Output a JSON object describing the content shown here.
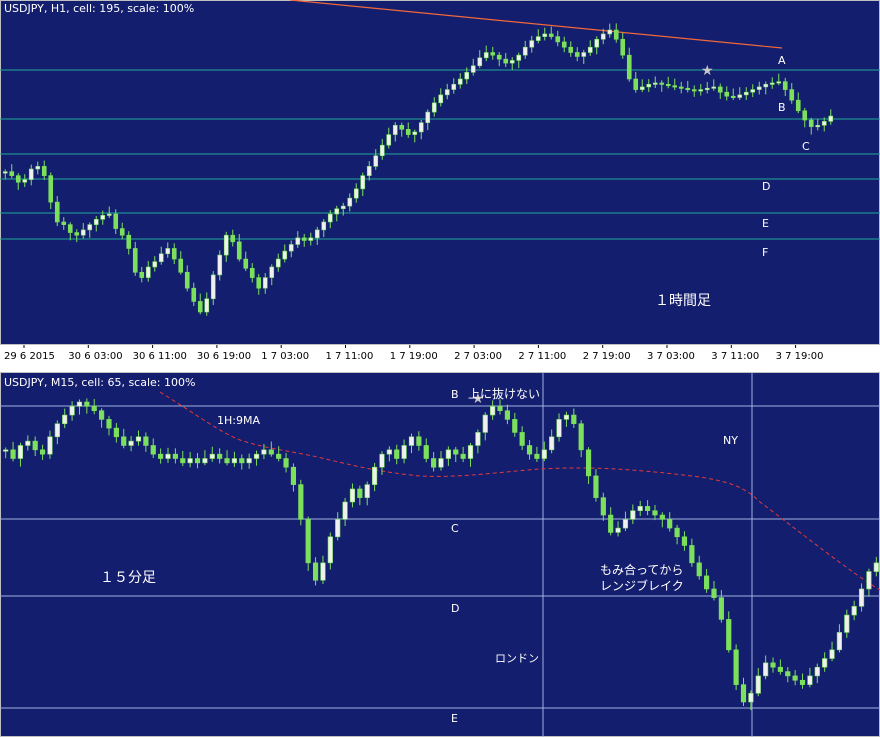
{
  "colors": {
    "background": "#141E6E",
    "grid_h1": "#20A898",
    "grid_m15": "#9FB3E0",
    "candle_bull": "#F0F0F0",
    "candle_bear": "#7CE05C",
    "wick": "#7CE05C",
    "trend_line": "#F2683A",
    "ma_line": "#E23A3A",
    "star": "#C8C8C8",
    "text": "#FFFFFF"
  },
  "chart_data": [
    {
      "type": "candlestick",
      "panel_title": "USDJPY, H1, cell: 195, scale: 100%",
      "annotation": "１時間足",
      "levels": [
        "A",
        "B",
        "C",
        "D",
        "E",
        "F"
      ],
      "x_tick_labels": [
        "29 6 2015",
        "30 6 03:00",
        "30 6 11:00",
        "30 6 19:00",
        "1 7 03:00",
        "1 7 11:00",
        "1 7 19:00",
        "2 7 03:00",
        "2 7 11:00",
        "2 7 19:00",
        "3 7 03:00",
        "3 7 11:00",
        "3 7 19:00"
      ],
      "close_series": [
        122.58,
        122.55,
        122.5,
        122.52,
        122.6,
        122.62,
        122.55,
        122.35,
        122.2,
        122.18,
        122.12,
        122.1,
        122.14,
        122.18,
        122.22,
        122.25,
        122.26,
        122.15,
        122.1,
        122.0,
        121.82,
        121.78,
        121.86,
        121.9,
        121.96,
        122.0,
        121.92,
        121.82,
        121.7,
        121.6,
        121.52,
        121.62,
        121.8,
        121.95,
        122.1,
        122.05,
        121.92,
        121.85,
        121.78,
        121.7,
        121.78,
        121.86,
        121.92,
        121.98,
        122.03,
        122.08,
        122.06,
        122.08,
        122.14,
        122.2,
        122.26,
        122.3,
        122.32,
        122.38,
        122.45,
        122.55,
        122.62,
        122.7,
        122.78,
        122.86,
        122.93,
        122.9,
        122.86,
        122.88,
        122.95,
        123.03,
        123.1,
        123.16,
        123.2,
        123.24,
        123.28,
        123.33,
        123.38,
        123.44,
        123.48,
        123.46,
        123.43,
        123.4,
        123.42,
        123.46,
        123.52,
        123.57,
        123.6,
        123.62,
        123.6,
        123.56,
        123.52,
        123.48,
        123.45,
        123.48,
        123.52,
        123.58,
        123.62,
        123.65,
        123.58,
        123.46,
        123.28,
        123.2,
        123.22,
        123.24,
        123.25,
        123.24,
        123.23,
        123.22,
        123.21,
        123.2,
        123.19,
        123.2,
        123.21,
        123.22,
        123.18,
        123.15,
        123.14,
        123.16,
        123.18,
        123.2,
        123.22,
        123.24,
        123.25,
        123.26,
        123.2,
        123.12,
        123.04,
        122.97,
        122.92,
        122.93,
        122.96,
        123.0
      ],
      "stars_at_index": [
        108
      ]
    },
    {
      "type": "candlestick",
      "panel_title": "USDJPY, M15, cell: 65, scale: 100%",
      "ma_label": "1H:9MA",
      "annotations": [
        "上に抜けない",
        "もみ合ってから",
        "レンジブレイク",
        "１５分足",
        "ロンドン",
        "NY"
      ],
      "levels": [
        "B",
        "C",
        "D",
        "E"
      ],
      "close_series": [
        123.24,
        123.22,
        123.25,
        123.26,
        123.24,
        123.23,
        123.27,
        123.3,
        123.32,
        123.34,
        123.35,
        123.34,
        123.33,
        123.31,
        123.29,
        123.27,
        123.25,
        123.26,
        123.27,
        123.25,
        123.23,
        123.22,
        123.23,
        123.22,
        123.21,
        123.22,
        123.21,
        123.22,
        123.23,
        123.22,
        123.21,
        123.22,
        123.21,
        123.22,
        123.23,
        123.24,
        123.23,
        123.22,
        123.2,
        123.16,
        123.08,
        122.98,
        122.94,
        122.98,
        123.04,
        123.08,
        123.12,
        123.15,
        123.13,
        123.16,
        123.2,
        123.23,
        123.24,
        123.22,
        123.25,
        123.27,
        123.25,
        123.22,
        123.2,
        123.22,
        123.24,
        123.23,
        123.22,
        123.25,
        123.28,
        123.32,
        123.34,
        123.33,
        123.31,
        123.28,
        123.25,
        123.23,
        123.22,
        123.24,
        123.27,
        123.31,
        123.32,
        123.3,
        123.24,
        123.18,
        123.13,
        123.09,
        123.05,
        123.06,
        123.08,
        123.1,
        123.11,
        123.1,
        123.09,
        123.08,
        123.06,
        123.04,
        123.02,
        122.98,
        122.95,
        122.92,
        122.9,
        122.85,
        122.78,
        122.7,
        122.66,
        122.68,
        122.72,
        122.75,
        122.74,
        122.73,
        122.72,
        122.71,
        122.7,
        122.72,
        122.74,
        122.76,
        122.78,
        122.82,
        122.86,
        122.88,
        122.92,
        122.96,
        122.98
      ],
      "stars_at_index": [
        64
      ]
    }
  ]
}
